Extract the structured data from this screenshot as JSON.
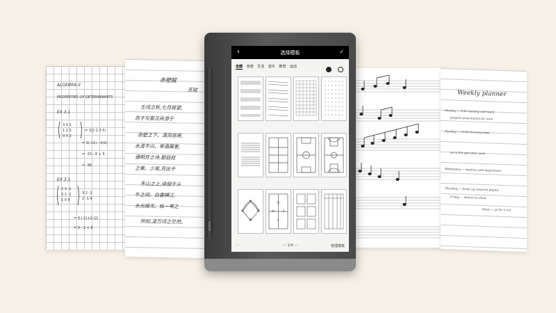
{
  "screen": {
    "header": {
      "back_icon": "‹",
      "title": "选择模板",
      "confirm_icon": "✓"
    },
    "categories": [
      "全部",
      "普通",
      "生活",
      "音乐",
      "教育",
      "运动"
    ],
    "view_icons": [
      "view-mode-icon",
      "settings-icon"
    ],
    "footer": {
      "page_indicator": "‹ ‹ 1/4 › ›",
      "manage_label": "管理模板"
    }
  },
  "sheets": {
    "math": {
      "title": "ALGEBRA II",
      "line1": "PROPERTIES OF DETERMINANTS",
      "ex1": "EX 3.1",
      "ex2": "EX 3.1"
    },
    "chinese": {
      "title": "赤壁赋",
      "author": "苏轼",
      "lines": [
        "壬戌之秋,七月既望,",
        "苏子与客泛舟游于",
        "赤壁之下。清风徐来,",
        "水波不兴。举酒属客,",
        "诵明月之诗,歌窈窕",
        "之章。少焉,月出于",
        "东山之上,徘徊于斗",
        "牛之间。白露横江,",
        "水光接天。纵一苇之",
        "所如,凌万顷之茫然。"
      ]
    },
    "planner": {
      "title": "Weekly planner",
      "lines": [
        "Monday — 9:30 meeting with team",
        "prepare presentation for work",
        "Tuesday — 10:00 drawing class",
        "go to the gym after work",
        "Wednesday — meeting with department",
        "Thursday — finish up research project",
        "Friday — deliver to client",
        "focus — go for a run"
      ]
    }
  }
}
